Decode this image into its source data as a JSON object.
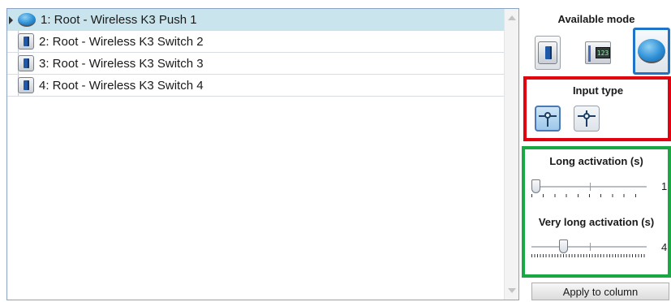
{
  "device_list": {
    "rows": [
      {
        "label": "1: Root - Wireless K3 Push 1",
        "icon": "push-button-icon",
        "selected": true
      },
      {
        "label": "2: Root - Wireless K3 Switch 2",
        "icon": "switch-icon",
        "selected": false
      },
      {
        "label": "3: Root - Wireless K3 Switch 3",
        "icon": "switch-icon",
        "selected": false
      },
      {
        "label": "4: Root - Wireless K3 Switch 4",
        "icon": "switch-icon",
        "selected": false
      }
    ]
  },
  "available_mode": {
    "title": "Available mode",
    "options": [
      "switch-mode-icon",
      "dimmer-mode-icon",
      "push-button-mode-icon"
    ],
    "dimmer_display": "123",
    "selected": "push-button-mode-icon"
  },
  "input_type": {
    "title": "Input type",
    "options": [
      "input-type-a-icon",
      "input-type-b-icon"
    ],
    "selected": "input-type-a-icon"
  },
  "long_activation": {
    "title": "Long activation (s)",
    "value": "1"
  },
  "very_long_activation": {
    "title": "Very long activation (s)",
    "value": "4"
  },
  "apply_label": "Apply to column",
  "colors": {
    "selected_row": "#c9e4ec",
    "mode_highlight": "#1f73c8",
    "input_box_border": "#e3000f",
    "activation_box_border": "#1aa845"
  }
}
